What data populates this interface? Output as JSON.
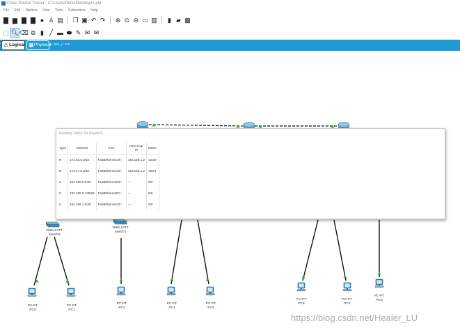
{
  "window": {
    "title": "Cisco Packet Tracer - C:\\Users\\Pkcc\\Desktop\\1.pkt"
  },
  "menubar": {
    "items": [
      "File",
      "Edit",
      "Options",
      "View",
      "Tools",
      "Extensions",
      "Help"
    ]
  },
  "tabs": {
    "logical": "Logical",
    "physical": "Physical",
    "coords": "x: 656, y: 475"
  },
  "routing_table": {
    "title": "Routing Table for Router0",
    "columns": [
      "Type",
      "Network",
      "Port",
      "Next Hop IP",
      "Metric"
    ],
    "rows": [
      {
        "type": "R",
        "network": "172.16.0.0/16",
        "port": "FastEthernet1/0",
        "next_hop": "192.168.1.2",
        "metric": "120/2"
      },
      {
        "type": "R",
        "network": "172.17.0.0/30",
        "port": "FastEthernet1/0",
        "next_hop": "192.168.1.2",
        "metric": "120/1"
      },
      {
        "type": "C",
        "network": "192.168.0.0/25",
        "port": "FastEthernet0/0",
        "next_hop": "---",
        "metric": "0/0"
      },
      {
        "type": "C",
        "network": "192.168.0.128/25",
        "port": "FastEthernet0/1",
        "next_hop": "---",
        "metric": "0/0"
      },
      {
        "type": "C",
        "network": "192.168.1.0/30",
        "port": "FastEthernet1/0",
        "next_hop": "---",
        "metric": "0/0"
      }
    ]
  },
  "devices": {
    "switch0": {
      "model": "2960-24TT",
      "name": "Switch0"
    },
    "switch1": {
      "model": "2960-24TT",
      "name": "Switch1"
    },
    "pcs": [
      {
        "type": "PC-PT",
        "name": "PC0"
      },
      {
        "type": "PC-PT",
        "name": "PC1"
      },
      {
        "type": "PC-PT",
        "name": "PC2"
      },
      {
        "type": "PC-PT",
        "name": "PC4"
      },
      {
        "type": "PC-PT",
        "name": "PC5"
      },
      {
        "type": "PC-PT",
        "name": "PC6"
      },
      {
        "type": "PC-PT",
        "name": "PC7"
      },
      {
        "type": "PC-PT",
        "name": "PC8"
      }
    ]
  },
  "watermark": "https://blog.csdn.net/Healer_LU",
  "colors": {
    "tab_bar": "#1e9ad6",
    "link_up": "#2db82d",
    "device_blue": "#3f8fb8"
  }
}
